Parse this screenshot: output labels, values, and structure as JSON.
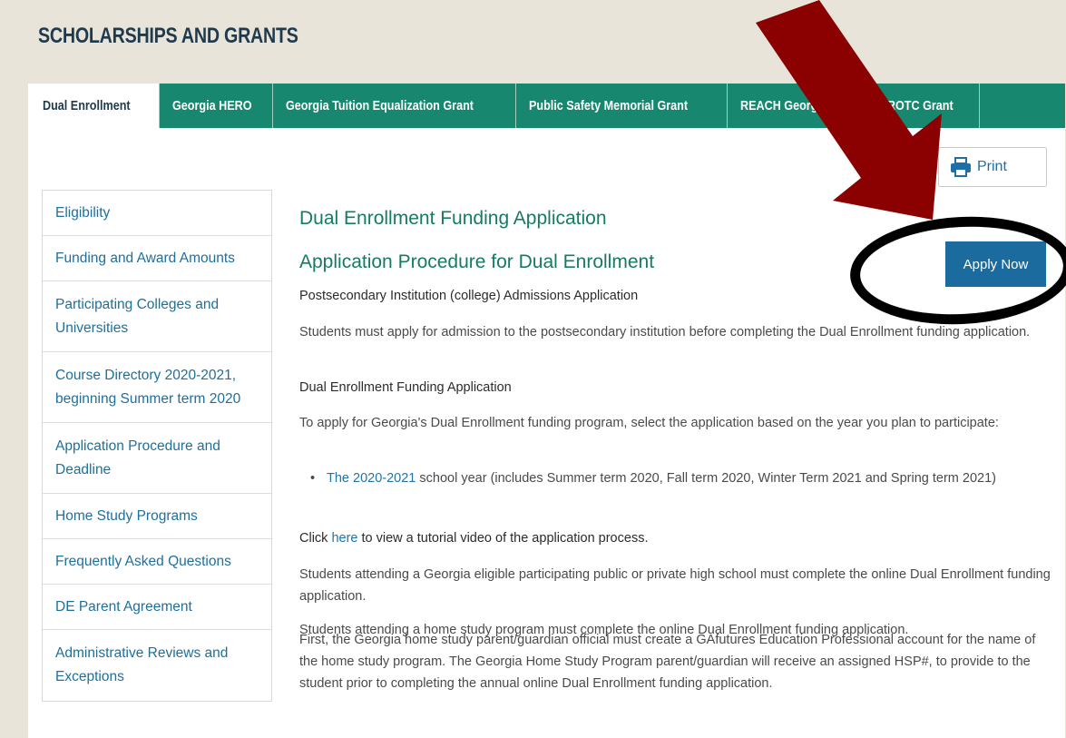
{
  "page": {
    "title": "SCHOLARSHIPS AND GRANTS"
  },
  "tabs": [
    {
      "label": "Dual Enrollment",
      "active": true
    },
    {
      "label": "Georgia HERO"
    },
    {
      "label": "Georgia Tuition Equalization Grant"
    },
    {
      "label": "Public Safety Memorial Grant"
    },
    {
      "label": "REACH Georgia"
    },
    {
      "label": "ING ROTC Grant"
    }
  ],
  "print": {
    "label": "Print",
    "icon": "printer-icon"
  },
  "sidebar": {
    "items": [
      {
        "label": "Eligibility"
      },
      {
        "label": "Funding and Award Amounts"
      },
      {
        "label": "Participating Colleges and Universities"
      },
      {
        "label": "Course Directory 2020-2021, beginning Summer term 2020"
      },
      {
        "label": "Application Procedure and Deadline"
      },
      {
        "label": "Home Study Programs"
      },
      {
        "label": "Frequently Asked Questions"
      },
      {
        "label": "DE Parent Agreement"
      },
      {
        "label": "Administrative Reviews and Exceptions"
      }
    ]
  },
  "main": {
    "heading1": "Dual Enrollment Funding Application",
    "heading2": "Application Procedure for Dual Enrollment",
    "apply_label": "Apply Now",
    "section1_title": "Postsecondary Institution (college) Admissions Application",
    "section1_text": "Students must apply for admission to the postsecondary institution before completing the Dual Enrollment funding application.",
    "section2_title": "Dual Enrollment Funding Application",
    "section2_text": "To apply for Georgia's Dual Enrollment funding program, select the application based on the year you plan to participate:",
    "bullet_link": "The 2020-2021",
    "bullet_text": " school year (includes Summer term 2020, Fall term 2020, Winter Term 2021 and Spring term 2021)",
    "click_prefix": "Click ",
    "click_link": "here",
    "click_suffix": " to view a tutorial video of the application process.",
    "para1": "Students attending a Georgia eligible participating public or private high school must complete the online Dual Enrollment funding application.",
    "para2": "Students attending a home study program must complete the online Dual Enrollment funding application.",
    "para3": "First, the Georgia home study parent/guardian official must create a GAfutures Education Professional account for the name of the home study program. The Georgia Home Study Program parent/guardian will receive an assigned HSP#, to provide to the student prior to completing the annual online Dual Enrollment funding application."
  },
  "colors": {
    "tab_green": "#17886f",
    "heading_green": "#167a64",
    "link_blue": "#1f74a8",
    "apply_blue": "#1b6b9e",
    "arrow_red": "#8b0000"
  }
}
